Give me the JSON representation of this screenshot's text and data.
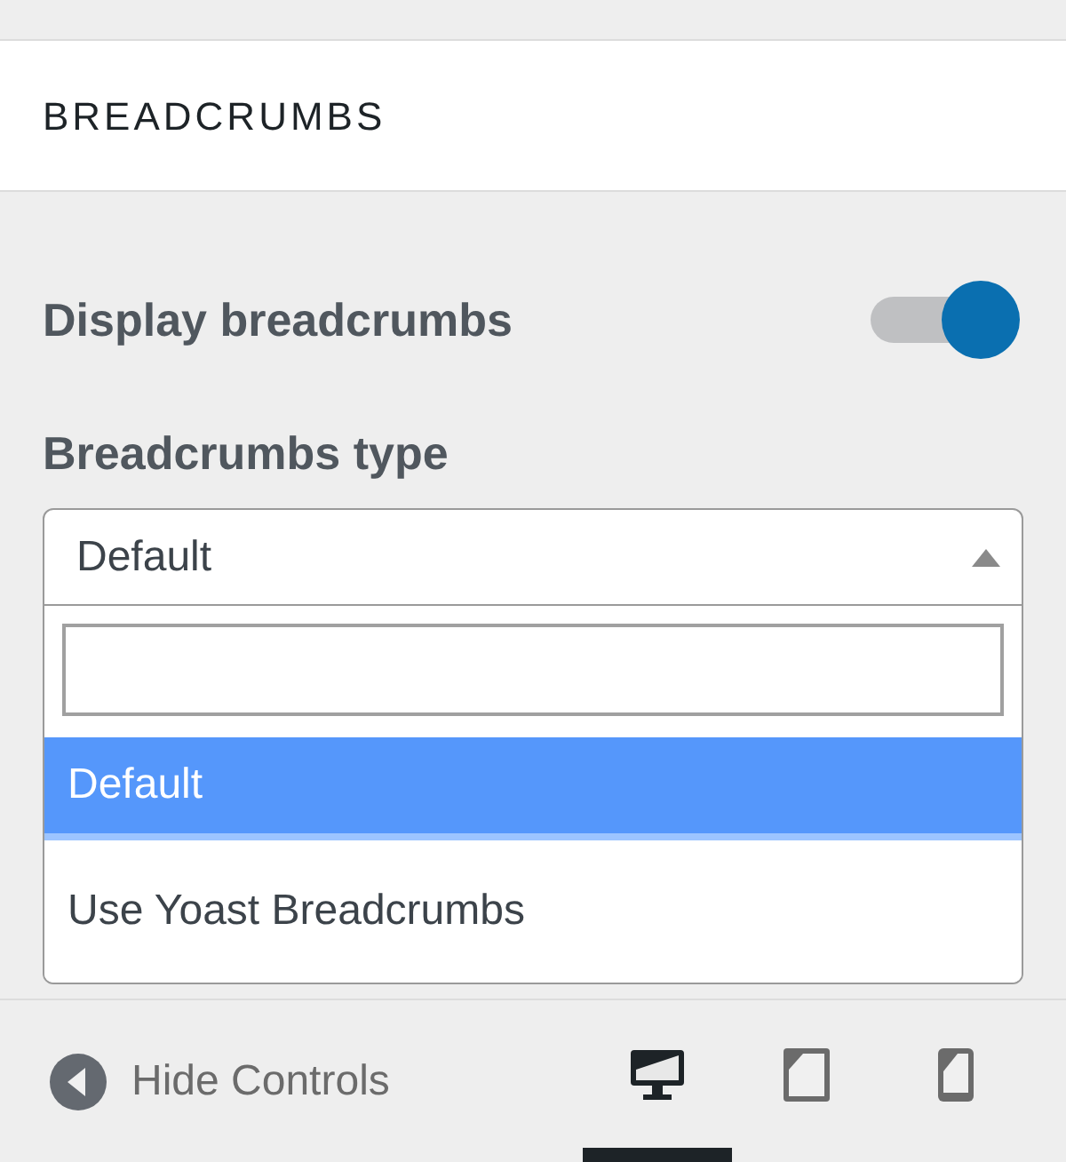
{
  "section": {
    "title": "BREADCRUMBS"
  },
  "toggle": {
    "label": "Display breadcrumbs",
    "on": true
  },
  "select": {
    "label": "Breadcrumbs type",
    "value": "Default",
    "expanded": true,
    "options": [
      {
        "label": "Default",
        "selected": true
      },
      {
        "label": "Use Yoast Breadcrumbs",
        "selected": false
      }
    ]
  },
  "footer": {
    "hide_label": "Hide Controls",
    "devices": [
      {
        "kind": "desktop",
        "selected": true
      },
      {
        "kind": "tablet",
        "selected": false
      },
      {
        "kind": "mobile",
        "selected": false
      }
    ]
  }
}
